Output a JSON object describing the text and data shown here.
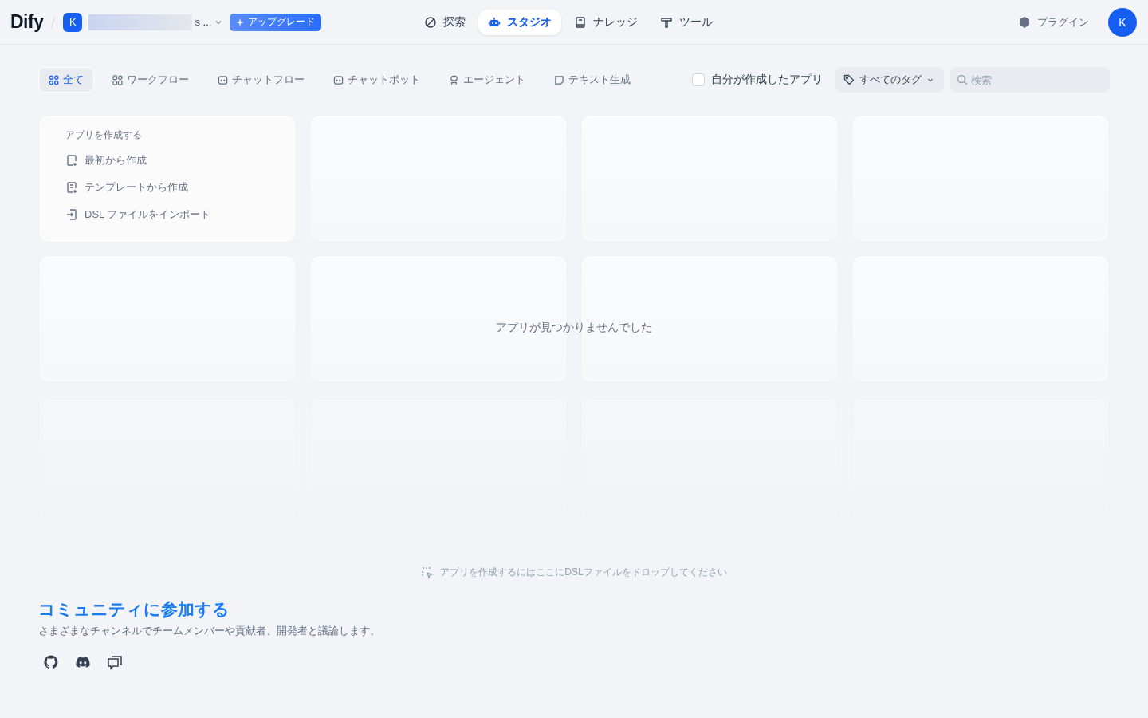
{
  "header": {
    "logo": "Dify",
    "workspace": {
      "avatar": "K",
      "name": "s ..."
    },
    "upgrade": "アップグレード",
    "nav": [
      {
        "label": "探索",
        "kind": "explore",
        "selected": false
      },
      {
        "label": "スタジオ",
        "kind": "studio",
        "selected": true
      },
      {
        "label": "ナレッジ",
        "kind": "knowledge",
        "selected": false
      },
      {
        "label": "ツール",
        "kind": "tools",
        "selected": false
      }
    ],
    "plugin": "プラグイン",
    "avatar": "K"
  },
  "filters": {
    "tabs": [
      {
        "label": "全て",
        "kind": "all",
        "selected": true
      },
      {
        "label": "ワークフロー",
        "kind": "workflow",
        "selected": false
      },
      {
        "label": "チャットフロー",
        "kind": "chat",
        "selected": false
      },
      {
        "label": "チャットボット",
        "kind": "chat",
        "selected": false
      },
      {
        "label": "エージェント",
        "kind": "agent",
        "selected": false
      },
      {
        "label": "テキスト生成",
        "kind": "text",
        "selected": false
      }
    ],
    "mine": {
      "label": "自分が作成したアプリ",
      "checked": false
    },
    "tags": "すべてのタグ",
    "search": {
      "placeholder": "検索"
    }
  },
  "create_card": {
    "title": "アプリを作成する",
    "items": [
      {
        "label": "最初から作成",
        "kind": "blank"
      },
      {
        "label": "テンプレートから作成",
        "kind": "template"
      },
      {
        "label": "DSL ファイルをインポート",
        "kind": "import"
      }
    ]
  },
  "empty_message": "アプリが見つかりませんでした",
  "drop_hint": "アプリを作成するにはここにDSLファイルをドロップしてください",
  "community": {
    "title": "コミュニティに参加する",
    "text": "さまざまなチャンネルでチームメンバーや貢献者、開発者と議論します。",
    "links": [
      {
        "kind": "github"
      },
      {
        "kind": "discord"
      },
      {
        "kind": "forum"
      }
    ]
  }
}
